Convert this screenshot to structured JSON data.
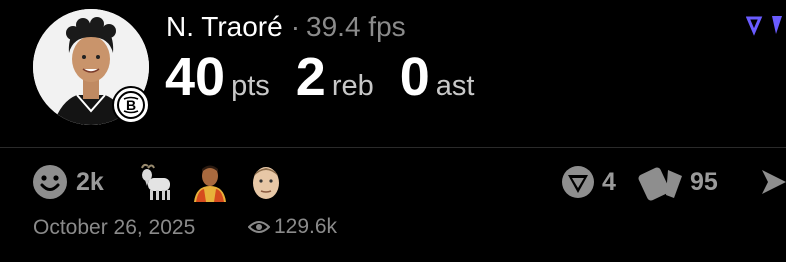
{
  "post": {
    "player_name": "N. Traoré",
    "separator": "·",
    "fps": "39.4 fps",
    "stats": [
      {
        "value": "40",
        "unit": "pts"
      },
      {
        "value": "2",
        "unit": "reb"
      },
      {
        "value": "0",
        "unit": "ast"
      }
    ],
    "team_badge_icon": "brooklyn-nets-logo-icon"
  },
  "reactions": {
    "smile_count": "2k",
    "emojis": [
      "smile-icon",
      "goat-icon",
      "person-emoji-icon",
      "player-face-icon"
    ]
  },
  "actions": {
    "reposts": "4",
    "cards": "95"
  },
  "footer": {
    "date": "October 26, 2025",
    "views": "129.6k"
  },
  "colors": {
    "background": "#000000",
    "accent": "#6a5cff",
    "muted": "#8b8b8b"
  }
}
